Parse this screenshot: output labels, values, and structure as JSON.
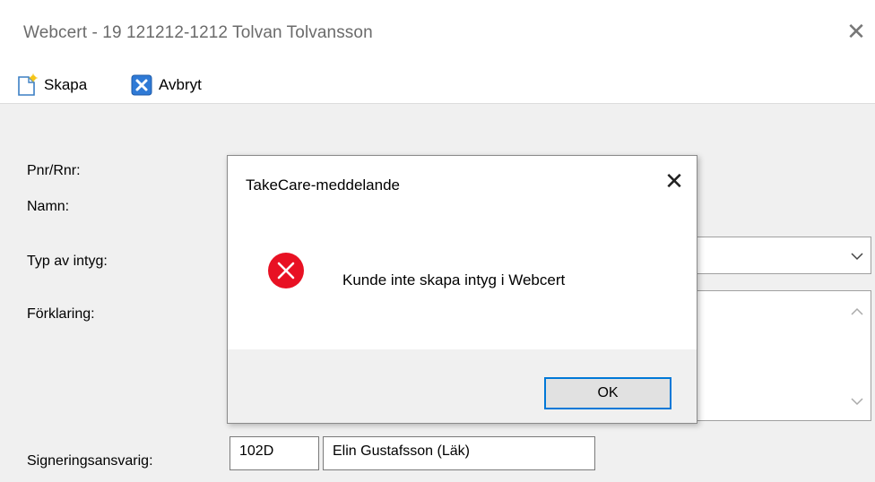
{
  "window": {
    "title": "Webcert - 19 121212-1212 Tolvan Tolvansson",
    "close_glyph": "✕"
  },
  "toolbar": {
    "create_label": "Skapa",
    "cancel_label": "Avbryt",
    "create_icon": "new-document-icon",
    "cancel_icon": "close-x-icon"
  },
  "form": {
    "pnr_label": "Pnr/Rnr:",
    "name_label": "Namn:",
    "type_label": "Typ av intyg:",
    "explanation_label": "Förklaring:",
    "signer_label": "Signeringsansvarig:",
    "signer_code": "102D",
    "signer_name": "Elin Gustafsson (Läk)"
  },
  "dialog": {
    "title": "TakeCare-meddelande",
    "message": "Kunde inte skapa intyg i Webcert",
    "ok_label": "OK",
    "close_glyph": "✕",
    "icon": "error-icon",
    "colors": {
      "error": "#e81123",
      "ok_border": "#0078d7"
    }
  }
}
